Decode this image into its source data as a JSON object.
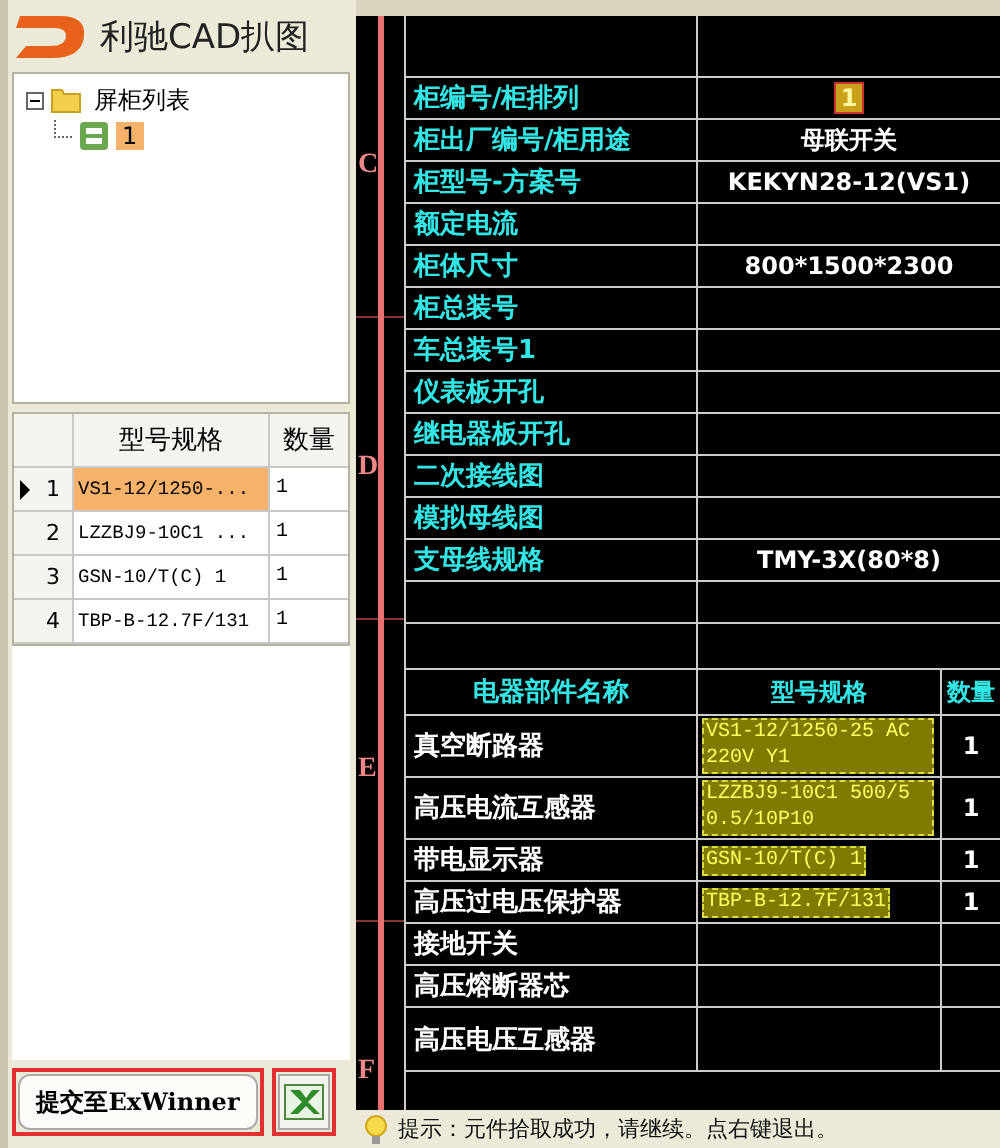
{
  "app": {
    "title": "利驰CAD扒图"
  },
  "tree": {
    "root": {
      "label": "屏柜列表",
      "expanded": true,
      "children": [
        {
          "label": "1",
          "selected": true
        }
      ]
    }
  },
  "grid": {
    "columns": [
      "型号规格",
      "数量"
    ],
    "rows": [
      {
        "index": "1",
        "model": "VS1-12/1250-...",
        "qty": "1",
        "selected": true
      },
      {
        "index": "2",
        "model": "LZZBJ9-10C1 ...",
        "qty": "1",
        "selected": false
      },
      {
        "index": "3",
        "model": "GSN-10/T(C) 1",
        "qty": "1",
        "selected": false
      },
      {
        "index": "4",
        "model": "TBP-B-12.7F/131",
        "qty": "1",
        "selected": false
      }
    ]
  },
  "buttons": {
    "submit": "提交至ExWinner"
  },
  "cad": {
    "ruler_marks": [
      "C",
      "D",
      "E",
      "F"
    ],
    "properties": [
      {
        "label": "柜编号/柜排列",
        "value": "1",
        "highlighted": true
      },
      {
        "label": "柜出厂编号/柜用途",
        "value": "母联开关",
        "highlighted": false
      },
      {
        "label": "柜型号-方案号",
        "value": "KEKYN28-12(VS1)",
        "highlighted": false
      },
      {
        "label": "额定电流"
      },
      {
        "label": "柜体尺寸",
        "value": "800*1500*2300",
        "highlighted": false
      },
      {
        "label": "柜总装号"
      },
      {
        "label": "车总装号1"
      },
      {
        "label": "仪表板开孔"
      },
      {
        "label": "继电器板开孔"
      },
      {
        "label": "二次接线图"
      },
      {
        "label": "模拟母线图"
      },
      {
        "label": "支母线规格",
        "value": "TMY-3X(80*8)",
        "highlighted": false
      }
    ],
    "component_columns": [
      "电器部件名称",
      "型号规格",
      "数量"
    ],
    "components": [
      {
        "name": "真空断路器",
        "model": "VS1-12/1250-25 AC 220V Y1",
        "qty": "1",
        "highlighted": true
      },
      {
        "name": "高压电流互感器",
        "model": "LZZBJ9-10C1 500/5 0.5/10P10",
        "qty": "1",
        "highlighted": true
      },
      {
        "name": "带电显示器",
        "model": "GSN-10/T(C) 1",
        "qty": "1",
        "highlighted": true
      },
      {
        "name": "高压过电压保护器",
        "model": "TBP-B-12.7F/131",
        "qty": "1",
        "highlighted": true
      },
      {
        "name": "接地开关"
      },
      {
        "name": "高压熔断器芯"
      },
      {
        "name": "高压电压互感器"
      }
    ]
  },
  "status_bar": {
    "text": "提示：元件拾取成功，请继续。点右键退出。"
  }
}
